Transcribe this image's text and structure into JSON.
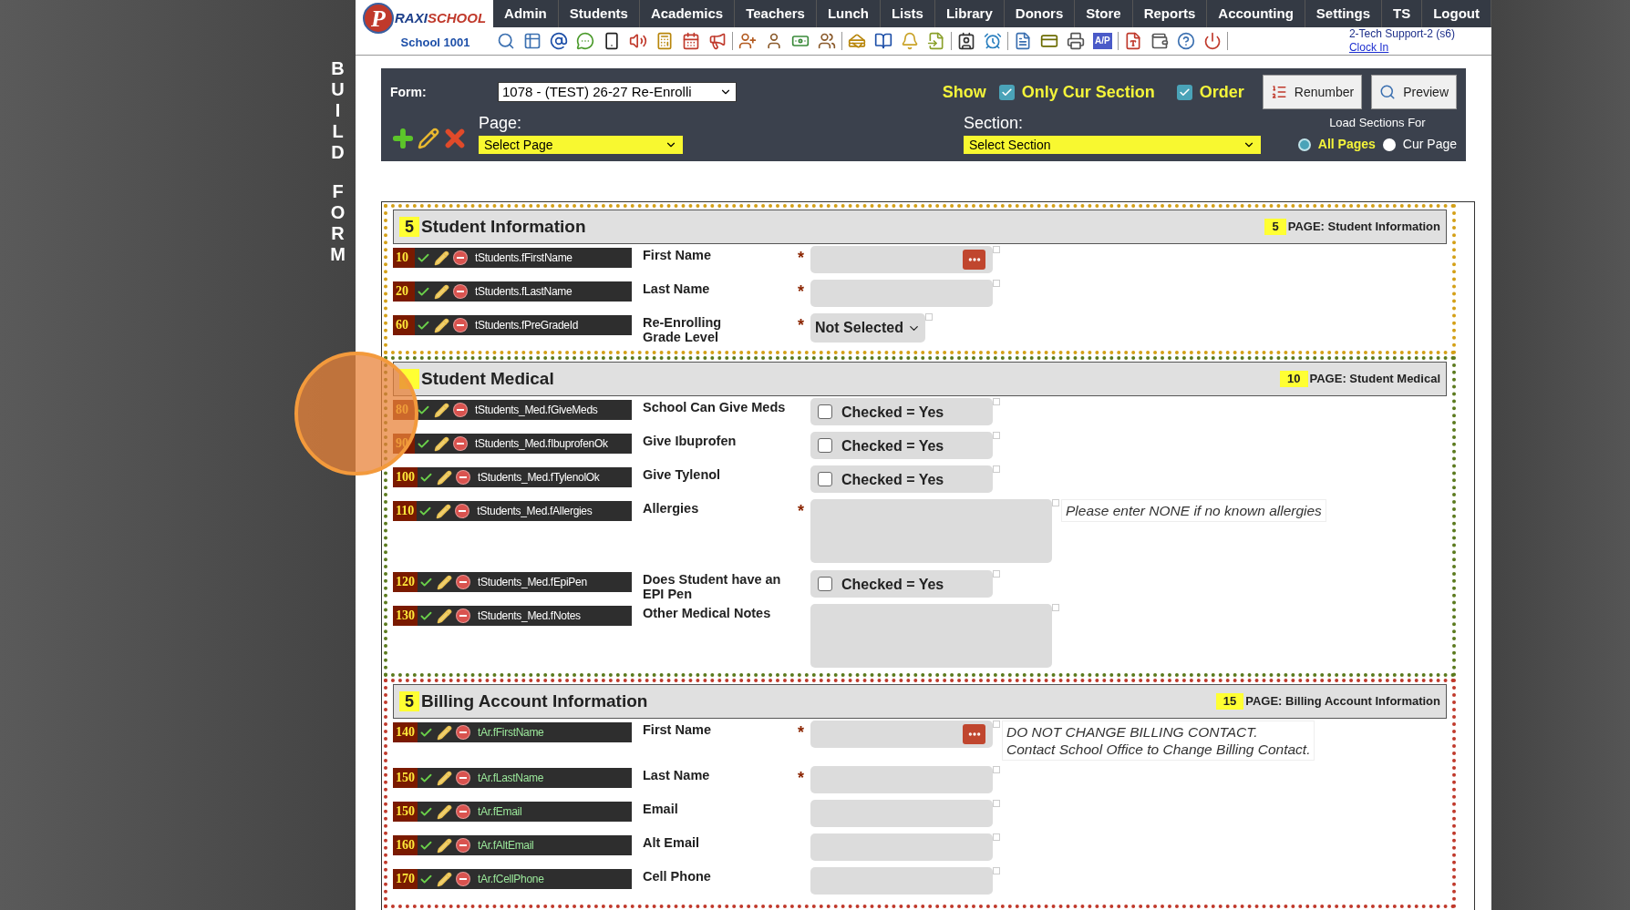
{
  "side_title": [
    "BUILD",
    "FORM"
  ],
  "logo": {
    "initial": "P",
    "name_part1": "RAXI",
    "name_part2": "SCHOOL",
    "subtitle": "School 1001"
  },
  "nav": [
    "Admin",
    "Students",
    "Academics",
    "Teachers",
    "Lunch",
    "Lists",
    "Library",
    "Donors",
    "Store",
    "Reports",
    "Accounting",
    "Settings",
    "TS",
    "Logout"
  ],
  "ap_label": "A/P",
  "user": {
    "name": "2-Tech Support-2 (s6)",
    "link": "Clock In"
  },
  "toolbar": {
    "form_label": "Form:",
    "form_value": "1078 - (TEST) 26-27 Re-Enrolli",
    "show_label": "Show",
    "options": [
      {
        "label": "Only Cur Section",
        "checked": true
      },
      {
        "label": "Order",
        "checked": true
      }
    ],
    "buttons": [
      {
        "kind": "renumber",
        "label": "Renumber"
      },
      {
        "kind": "preview",
        "label": "Preview"
      }
    ],
    "page_label": "Page:",
    "page_value": "Select Page",
    "section_label": "Section:",
    "section_value": "Select Section",
    "load_label": "Load Sections For",
    "radios": [
      {
        "label": "All Pages",
        "selected": true
      },
      {
        "label": "Cur Page",
        "selected": false
      }
    ]
  },
  "sections": [
    {
      "number": "5",
      "title": "Student Information",
      "page_number": "5",
      "page_title": "PAGE: Student Information",
      "color": "#d4a017",
      "rows": [
        {
          "order": "10",
          "field": "tStudents.fFirstName",
          "color": "#ffffff",
          "label": [
            "First Name"
          ],
          "asterisk": "*",
          "kind": "text",
          "button": true
        },
        {
          "order": "20",
          "field": "tStudents.fLastName",
          "color": "#ffffff",
          "label": [
            "Last Name"
          ],
          "asterisk": "*",
          "kind": "text",
          "button": false
        },
        {
          "order": "60",
          "field": "tStudents.fPreGradeId",
          "color": "#ffffff",
          "label": [
            "Re-Enrolling",
            "Grade Level"
          ],
          "asterisk": "*",
          "kind": "select",
          "value": "Not Selected"
        }
      ]
    },
    {
      "title": "Student Medical",
      "page_number": "10",
      "page_title": "PAGE: Student Medical",
      "color": "#5b7a1e",
      "rows": [
        {
          "order": "80",
          "field": "tStudents_Med.fGiveMeds",
          "color": "#ffffff",
          "label": [
            "School Can Give Meds"
          ],
          "kind": "checkbox",
          "value": "Checked = Yes",
          "checked": false
        },
        {
          "order": "90",
          "field": "tStudents_Med.fIbuprofenOk",
          "color": "#ffffff",
          "label": [
            "Give Ibuprofen"
          ],
          "kind": "checkbox",
          "value": "Checked = Yes",
          "checked": false
        },
        {
          "order": "100",
          "field": "tStudents_Med.fTylenolOk",
          "color": "#ffffff",
          "label": [
            "Give Tylenol"
          ],
          "kind": "checkbox",
          "value": "Checked = Yes",
          "checked": false
        },
        {
          "order": "110",
          "field": "tStudents_Med.fAllergies",
          "color": "#ffffff",
          "label": [
            "Allergies"
          ],
          "asterisk": "*",
          "kind": "textarea",
          "note": [
            "Please enter NONE if no known allergies"
          ]
        },
        {
          "order": "120",
          "field": "tStudents_Med.fEpiPen",
          "color": "#ffffff",
          "label": [
            "Does Student have an",
            "EPI Pen"
          ],
          "kind": "checkbox",
          "value": "Checked = Yes",
          "checked": false
        },
        {
          "order": "130",
          "field": "tStudents_Med.fNotes",
          "color": "#ffffff",
          "label": [
            "Other Medical Notes"
          ],
          "kind": "textarea"
        }
      ]
    },
    {
      "number": "5",
      "title": "Billing Account Information",
      "page_number": "15",
      "page_title": "PAGE: Billing Account Information",
      "color": "#c0392b",
      "rows": [
        {
          "order": "140",
          "field": "tAr.fFirstName",
          "color": "#9be89b",
          "label": [
            "First Name"
          ],
          "asterisk": "*",
          "kind": "text",
          "button": true,
          "note": [
            "DO NOT CHANGE BILLING CONTACT.",
            "Contact School Office to Change Billing Contact."
          ]
        },
        {
          "order": "150",
          "field": "tAr.fLastName",
          "color": "#9be89b",
          "label": [
            "Last Name"
          ],
          "asterisk": "*",
          "kind": "text",
          "button": false
        },
        {
          "order": "150",
          "field": "tAr.fEmail",
          "color": "#9be89b",
          "label": [
            "Email"
          ],
          "kind": "text",
          "button": false
        },
        {
          "order": "160",
          "field": "tAr.fAltEmail",
          "color": "#9be89b",
          "label": [
            "Alt Email"
          ],
          "kind": "text",
          "button": false
        },
        {
          "order": "170",
          "field": "tAr.fCellPhone",
          "color": "#9be89b",
          "label": [
            "Cell Phone"
          ],
          "kind": "text",
          "button": false
        }
      ]
    }
  ],
  "click_highlight": true
}
